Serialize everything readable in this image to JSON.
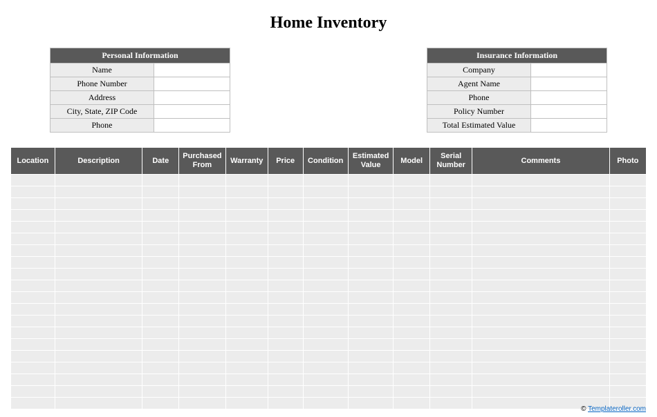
{
  "title": "Home Inventory",
  "personal": {
    "header": "Personal Information",
    "rows": [
      {
        "label": "Name",
        "value": ""
      },
      {
        "label": "Phone Number",
        "value": ""
      },
      {
        "label": "Address",
        "value": ""
      },
      {
        "label": "City, State, ZIP Code",
        "value": ""
      },
      {
        "label": "Phone",
        "value": ""
      }
    ]
  },
  "insurance": {
    "header": "Insurance Information",
    "rows": [
      {
        "label": "Company",
        "value": ""
      },
      {
        "label": "Agent Name",
        "value": ""
      },
      {
        "label": "Phone",
        "value": ""
      },
      {
        "label": "Policy Number",
        "value": ""
      },
      {
        "label": "Total Estimated Value",
        "value": ""
      }
    ]
  },
  "inventory": {
    "columns": [
      "Location",
      "Description",
      "Date",
      "Purchased From",
      "Warranty",
      "Price",
      "Condition",
      "Estimated Value",
      "Model",
      "Serial Number",
      "Comments",
      "Photo"
    ],
    "row_count": 20
  },
  "footer": {
    "copyright": "©",
    "link_text": "Templateroller.com"
  }
}
